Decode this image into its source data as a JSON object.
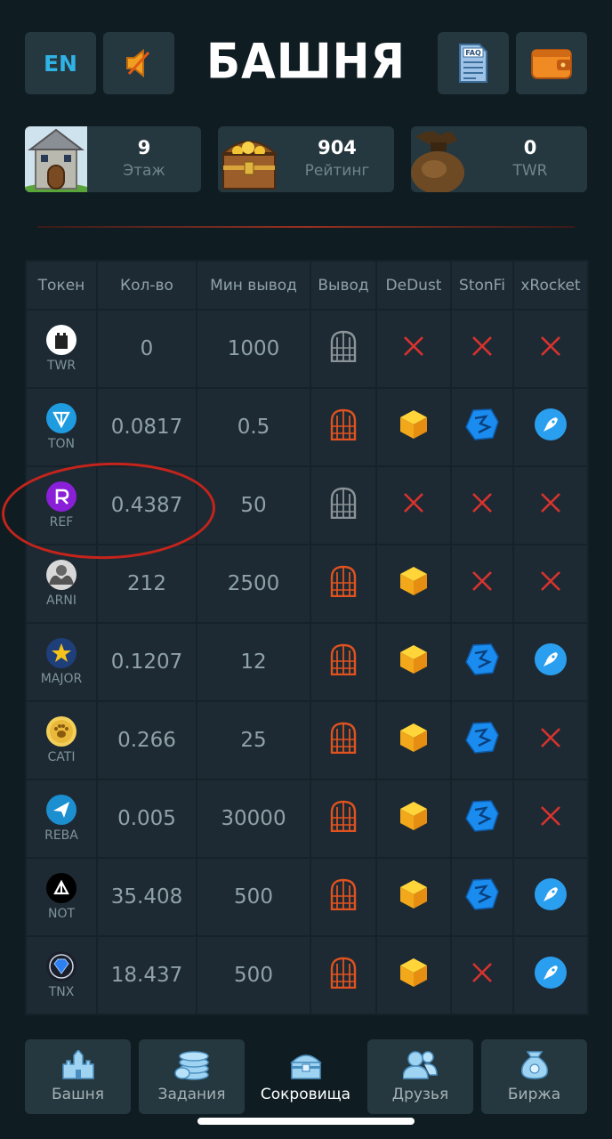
{
  "header": {
    "lang_label": "EN",
    "title": "БАШНЯ",
    "faq_label": "FAQ"
  },
  "stats": [
    {
      "value": "9",
      "label": "Этаж"
    },
    {
      "value": "904",
      "label": "Рейтинг"
    },
    {
      "value": "0",
      "label": "TWR"
    }
  ],
  "table": {
    "columns": [
      "Токен",
      "Кол-во",
      "Мин вывод",
      "Вывод",
      "DeDust",
      "StonFi",
      "xRocket"
    ],
    "rows": [
      {
        "token": "TWR",
        "amount": "0",
        "min": "1000",
        "withdraw": false,
        "dedust": false,
        "stonfi": false,
        "xrocket": false
      },
      {
        "token": "TON",
        "amount": "0.0817",
        "min": "0.5",
        "withdraw": true,
        "dedust": true,
        "stonfi": true,
        "xrocket": true
      },
      {
        "token": "REF",
        "amount": "0.4387",
        "min": "50",
        "withdraw": false,
        "dedust": false,
        "stonfi": false,
        "xrocket": false
      },
      {
        "token": "ARNI",
        "amount": "212",
        "min": "2500",
        "withdraw": true,
        "dedust": true,
        "stonfi": false,
        "xrocket": false
      },
      {
        "token": "MAJOR",
        "amount": "0.1207",
        "min": "12",
        "withdraw": true,
        "dedust": true,
        "stonfi": true,
        "xrocket": true
      },
      {
        "token": "CATI",
        "amount": "0.266",
        "min": "25",
        "withdraw": true,
        "dedust": true,
        "stonfi": true,
        "xrocket": false
      },
      {
        "token": "REBA",
        "amount": "0.005",
        "min": "30000",
        "withdraw": true,
        "dedust": true,
        "stonfi": true,
        "xrocket": false
      },
      {
        "token": "NOT",
        "amount": "35.408",
        "min": "500",
        "withdraw": true,
        "dedust": true,
        "stonfi": true,
        "xrocket": true
      },
      {
        "token": "TNX",
        "amount": "18.437",
        "min": "500",
        "withdraw": true,
        "dedust": true,
        "stonfi": false,
        "xrocket": true
      }
    ]
  },
  "nav": [
    {
      "label": "Башня",
      "icon": "castle-icon",
      "active": false
    },
    {
      "label": "Задания",
      "icon": "coins-icon",
      "active": false
    },
    {
      "label": "Сокровища",
      "icon": "treasure-chest-icon",
      "active": true
    },
    {
      "label": "Друзья",
      "icon": "friends-icon",
      "active": false
    },
    {
      "label": "Биржа",
      "icon": "money-bag-icon",
      "active": false
    }
  ],
  "colors": {
    "background": "#0f1d22",
    "panel": "#26383f",
    "table_bg": "#1e2a33",
    "accent_blue": "#2fb3e6",
    "door_orange": "#e0521f",
    "cross_red": "#d8332e",
    "annotation_red": "#c4241b"
  }
}
